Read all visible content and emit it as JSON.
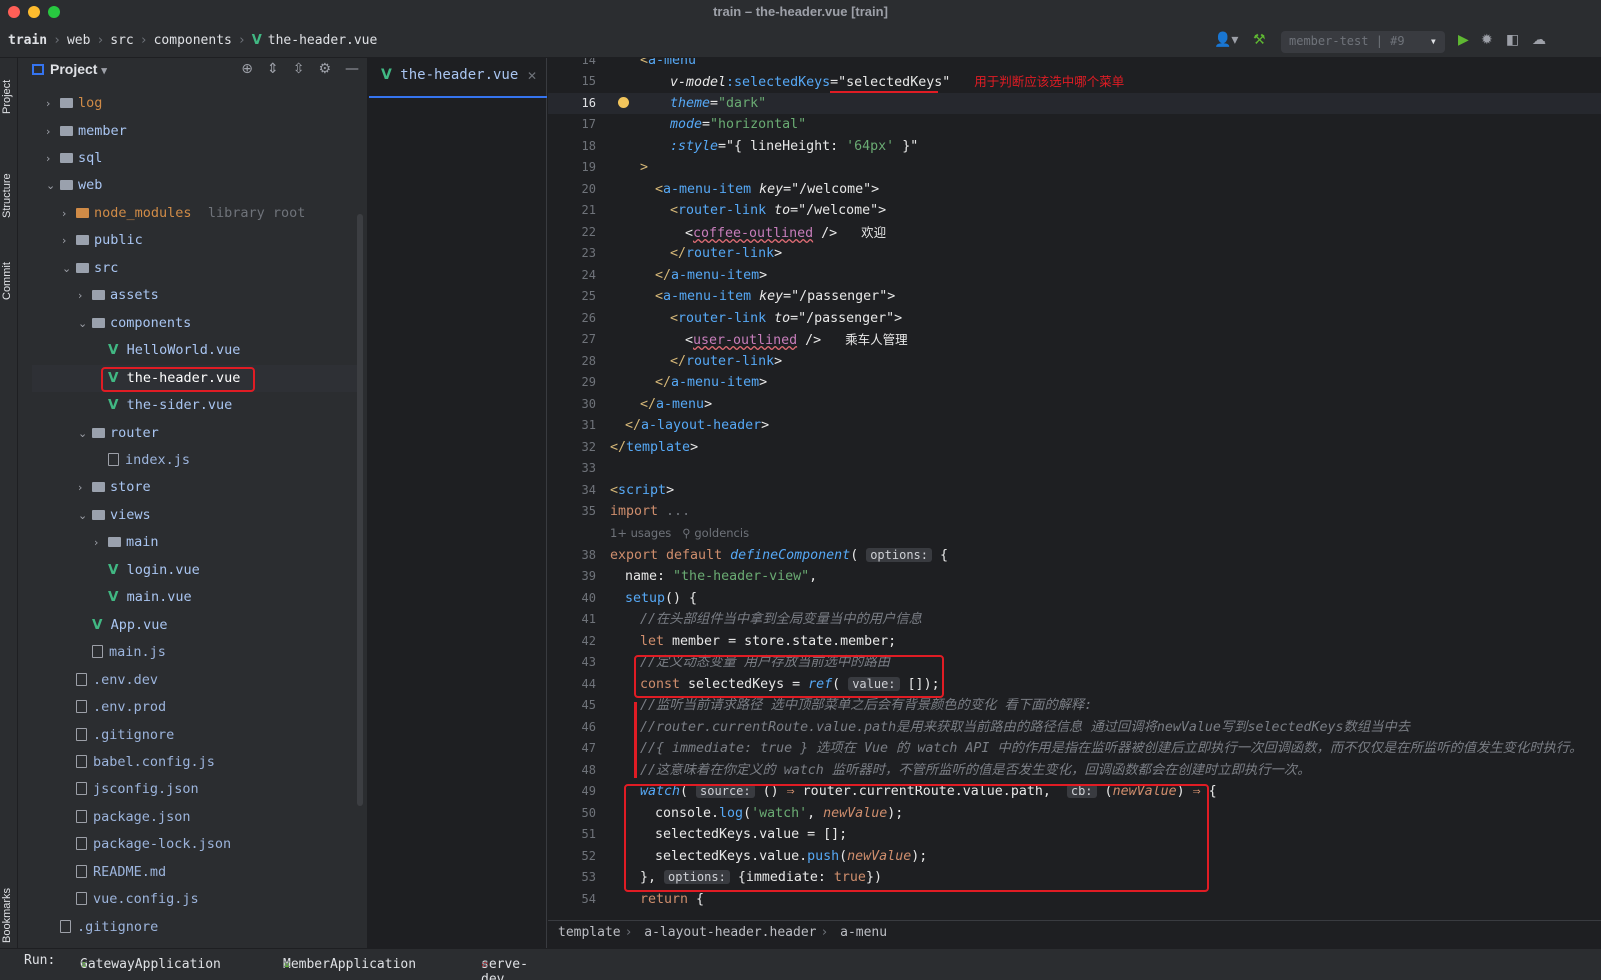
{
  "window": {
    "title": "train – the-header.vue [train]"
  },
  "navbar": {
    "crumbs": [
      "train",
      "web",
      "src",
      "components",
      "the-header.vue"
    ],
    "run_config": "member-test | #9"
  },
  "side_tabs": {
    "project": "Project",
    "structure": "Structure",
    "commit": "Commit",
    "bookmarks": "Bookmarks"
  },
  "project": {
    "title": "Project",
    "tree": [
      {
        "name": "log"
      },
      {
        "name": "member"
      },
      {
        "name": "sql"
      },
      {
        "name": "web"
      },
      {
        "name": "node_modules",
        "note": "library root"
      },
      {
        "name": "public"
      },
      {
        "name": "src"
      },
      {
        "name": "assets"
      },
      {
        "name": "components"
      },
      {
        "name": "HelloWorld.vue"
      },
      {
        "name": "the-header.vue"
      },
      {
        "name": "the-sider.vue"
      },
      {
        "name": "router"
      },
      {
        "name": "index.js"
      },
      {
        "name": "store"
      },
      {
        "name": "views"
      },
      {
        "name": "main"
      },
      {
        "name": "login.vue"
      },
      {
        "name": "main.vue"
      },
      {
        "name": "App.vue"
      },
      {
        "name": "main.js"
      },
      {
        "name": ".env.dev"
      },
      {
        "name": ".env.prod"
      },
      {
        "name": ".gitignore"
      },
      {
        "name": "babel.config.js"
      },
      {
        "name": "jsconfig.json"
      },
      {
        "name": "package.json"
      },
      {
        "name": "package-lock.json"
      },
      {
        "name": "README.md"
      },
      {
        "name": "vue.config.js"
      },
      {
        "name": ".gitignore"
      }
    ]
  },
  "editor": {
    "tab": "the-header.vue",
    "line_numbers": [
      "14",
      "15",
      "16",
      "17",
      "18",
      "19",
      "20",
      "21",
      "22",
      "23",
      "24",
      "25",
      "26",
      "27",
      "28",
      "29",
      "30",
      "31",
      "32",
      "33",
      "34",
      "35",
      "38",
      "39",
      "40",
      "41",
      "42",
      "43",
      "44",
      "45",
      "46",
      "47",
      "48",
      "49",
      "50",
      "51",
      "52",
      "53",
      "54"
    ],
    "annotation_1": "用于判断应该选中哪个菜单",
    "label_welcome": "欢迎",
    "label_passenger": "乘车人管理",
    "usages": "1+ usages",
    "author": "goldencis",
    "comment_41": "//在头部组件当中拿到全局变量当中的用户信息",
    "comment_43": "//定义动态变量 用户存放当前选中的路由",
    "comment_45": "//监听当前请求路径 选中顶部菜单之后会有背景颜色的变化 看下面的解释:",
    "comment_46": "//router.currentRoute.value.path是用来获取当前路由的路径信息 通过回调将newValue写到selectedKeys数组当中去",
    "comment_47": "//{ immediate: true } 选项在 Vue 的 watch API 中的作用是指在监听器被创建后立即执行一次回调函数，而不仅仅是在所监听的值发生变化时执行。",
    "comment_48": "//这意味着在你定义的 watch 监听器时，不管所监听的值是否发生变化，回调函数都会在创建时立即执行一次。"
  },
  "breadcrumb": [
    "template",
    "a-layout-header.header",
    "a-menu"
  ],
  "run": {
    "label": "Run:",
    "items": [
      "GatewayApplication",
      "MemberApplication",
      "serve-dev"
    ]
  }
}
